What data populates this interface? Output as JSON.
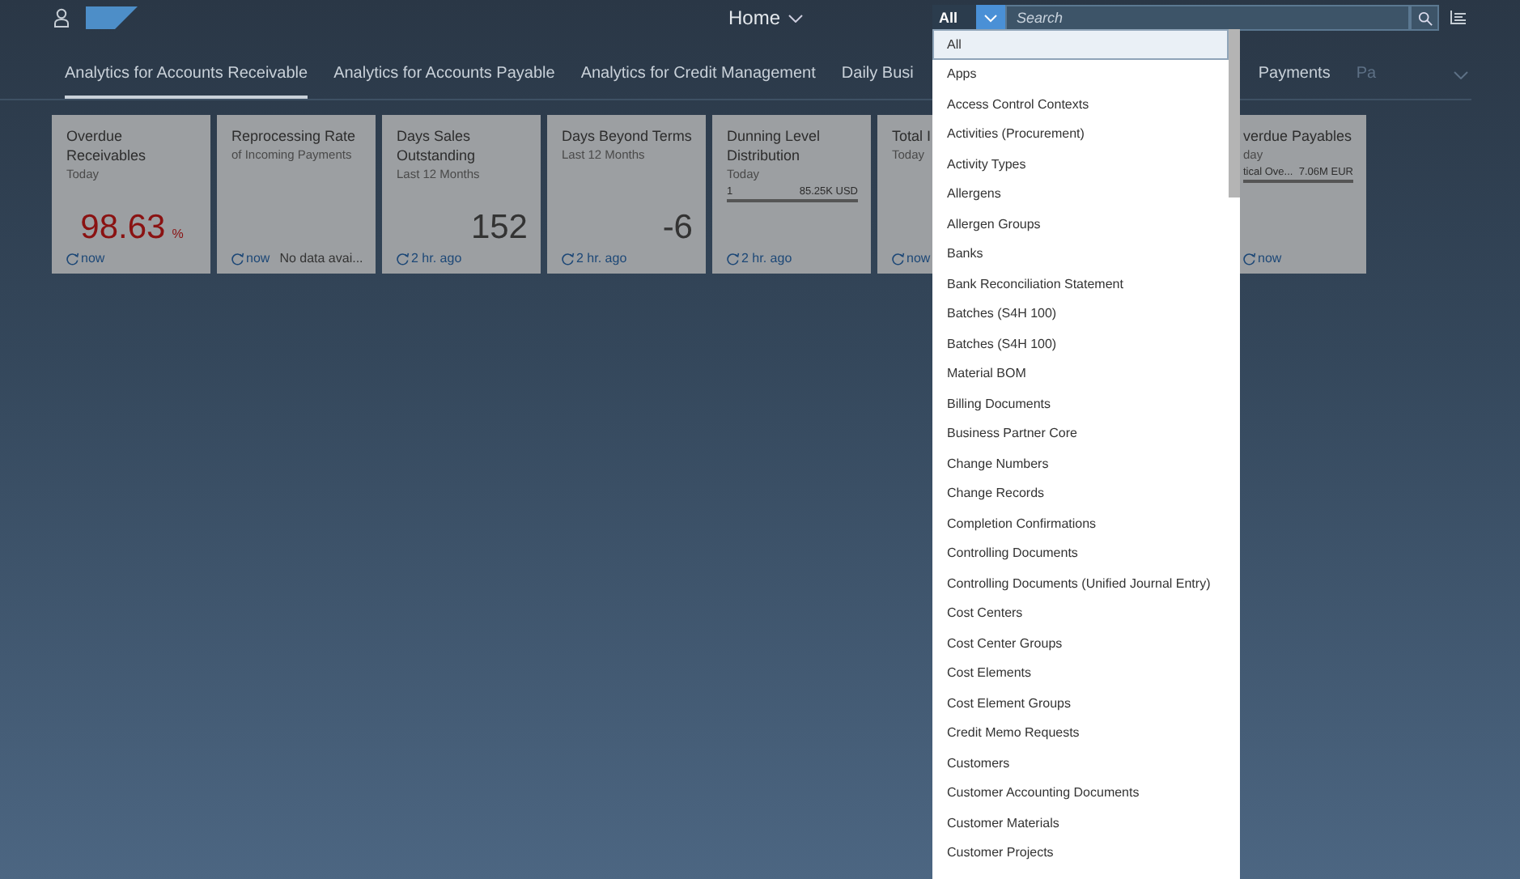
{
  "header": {
    "home": "Home",
    "scope": "All",
    "search": {
      "placeholder": "Search"
    }
  },
  "tabs": [
    {
      "label": "Analytics for Accounts Receivable",
      "selected": true,
      "kind": "normal"
    },
    {
      "label": "Analytics for Accounts Payable",
      "selected": false,
      "kind": "normal"
    },
    {
      "label": "Analytics for Credit Management",
      "selected": false,
      "kind": "normal"
    },
    {
      "label": "Daily Busi",
      "selected": false,
      "kind": "normal"
    },
    {
      "label": "Payments",
      "selected": false,
      "kind": "gap"
    },
    {
      "label": "Pa",
      "selected": false,
      "kind": "faded"
    }
  ],
  "tiles": [
    {
      "kind": "kpi",
      "title": "Overdue Receivables",
      "subtitle": "Today",
      "value": "98.63",
      "unit": "%",
      "negative": true,
      "refresh": "now"
    },
    {
      "kind": "nodata",
      "title": "Reprocessing Rate",
      "subtitle": "of Incoming Payments",
      "refresh": "now",
      "note": "No data avai..."
    },
    {
      "kind": "kpi",
      "title": "Days Sales Outstanding",
      "subtitle": "Last 12 Months",
      "value": "152",
      "negative": false,
      "refresh": "2 hr. ago"
    },
    {
      "kind": "kpi",
      "title": "Days Beyond Terms",
      "subtitle": "Last 12 Months",
      "value": "-6",
      "negative": false,
      "refresh": "2 hr. ago"
    },
    {
      "kind": "bar",
      "title": "Dunning Level Distribution",
      "subtitle": "Today",
      "bar_label": "1",
      "bar_value": "85.25K USD",
      "refresh": "2 hr. ago"
    },
    {
      "kind": "nodata",
      "title": "Total I",
      "subtitle": "Today",
      "refresh": "now"
    },
    {
      "kind": "hidden"
    },
    {
      "kind": "bar",
      "cut": true,
      "title": "verdue Payables",
      "subtitle": "day",
      "bar_label": "tical Ove...",
      "bar_value": "7.06M EUR",
      "refresh": "now"
    }
  ],
  "dropdown": {
    "items": [
      {
        "label": "All",
        "selected": true
      },
      {
        "label": "Apps",
        "selected": false
      },
      {
        "label": "Access Control Contexts",
        "selected": false
      },
      {
        "label": "Activities (Procurement)",
        "selected": false
      },
      {
        "label": "Activity Types",
        "selected": false
      },
      {
        "label": "Allergens",
        "selected": false
      },
      {
        "label": "Allergen Groups",
        "selected": false
      },
      {
        "label": "Banks",
        "selected": false
      },
      {
        "label": "Bank Reconciliation Statement",
        "selected": false
      },
      {
        "label": "Batches (S4H 100)",
        "selected": false
      },
      {
        "label": "Batches (S4H 100)",
        "selected": false
      },
      {
        "label": "Material BOM",
        "selected": false
      },
      {
        "label": "Billing Documents",
        "selected": false
      },
      {
        "label": "Business Partner Core",
        "selected": false
      },
      {
        "label": "Change Numbers",
        "selected": false
      },
      {
        "label": "Change Records",
        "selected": false
      },
      {
        "label": "Completion Confirmations",
        "selected": false
      },
      {
        "label": "Controlling Documents",
        "selected": false
      },
      {
        "label": "Controlling Documents (Unified Journal Entry)",
        "selected": false
      },
      {
        "label": "Cost Centers",
        "selected": false
      },
      {
        "label": "Cost Center Groups",
        "selected": false
      },
      {
        "label": "Cost Elements",
        "selected": false
      },
      {
        "label": "Cost Element Groups",
        "selected": false
      },
      {
        "label": "Credit Memo Requests",
        "selected": false
      },
      {
        "label": "Customers",
        "selected": false
      },
      {
        "label": "Customer Accounting Documents",
        "selected": false
      },
      {
        "label": "Customer Materials",
        "selected": false
      },
      {
        "label": "Customer Projects",
        "selected": false
      }
    ]
  }
}
